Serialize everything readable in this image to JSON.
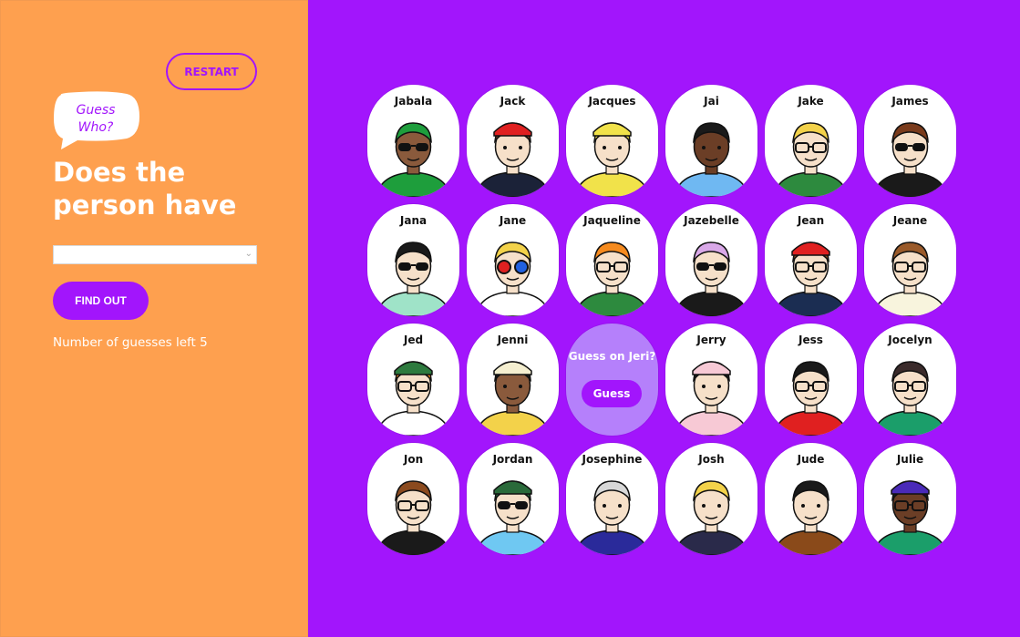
{
  "header": {
    "restart_label": "RESTART",
    "logo_line1": "Guess",
    "logo_line2": "Who?",
    "question": "Does the person have",
    "select_value": "",
    "findout_label": "FIND OUT",
    "guesses_text": "Number of guesses left 5"
  },
  "colors": {
    "panel": "#fea04f",
    "board": "#a215fc",
    "accent": "#a215fc",
    "highlight": "#b580fb"
  },
  "board": {
    "people": [
      {
        "name": "Jabala",
        "skin": "#8a5a3c",
        "hair": "#1e9e3c",
        "shirt": "#1e9e3c",
        "glasses": "sun",
        "hat": ""
      },
      {
        "name": "Jack",
        "skin": "#f6e0c9",
        "hair": "#6b3a1e",
        "shirt": "#1b2238",
        "glasses": "",
        "hat": "#e02020"
      },
      {
        "name": "Jacques",
        "skin": "#f6e0c9",
        "hair": "#f1e24a",
        "shirt": "#f1e24a",
        "glasses": "",
        "hat": "#f1e24a"
      },
      {
        "name": "Jai",
        "skin": "#6b3e26",
        "hair": "#1a1a1a",
        "shirt": "#6fb8f2",
        "glasses": "",
        "hat": ""
      },
      {
        "name": "Jake",
        "skin": "#f6e0c9",
        "hair": "#f3d24a",
        "shirt": "#2d8a3e",
        "glasses": "clear",
        "hat": ""
      },
      {
        "name": "James",
        "skin": "#f6e0c9",
        "hair": "#7a3b1c",
        "shirt": "#1a1a1a",
        "glasses": "sun",
        "hat": ""
      },
      {
        "name": "Jana",
        "skin": "#f6e0c9",
        "hair": "#1a1a1a",
        "shirt": "#9fe3c8",
        "glasses": "sun",
        "hat": ""
      },
      {
        "name": "Jane",
        "skin": "#f6e0c9",
        "hair": "#f3d24a",
        "shirt": "#ffffff",
        "glasses": "color",
        "hat": ""
      },
      {
        "name": "Jaqueline",
        "skin": "#f6e0c9",
        "hair": "#f58a1e",
        "shirt": "#2d8a3e",
        "glasses": "clear",
        "hat": ""
      },
      {
        "name": "Jazebelle",
        "skin": "#f6e0c9",
        "hair": "#d9a8e8",
        "shirt": "#1a1a1a",
        "glasses": "sun",
        "hat": ""
      },
      {
        "name": "Jean",
        "skin": "#f6e0c9",
        "hair": "#8b4a1e",
        "shirt": "#1b2d52",
        "glasses": "clear",
        "hat": "#e02020"
      },
      {
        "name": "Jeane",
        "skin": "#f6e0c9",
        "hair": "#9a5a2a",
        "shirt": "#f8f4dd",
        "glasses": "clear",
        "hat": ""
      },
      {
        "name": "Jed",
        "skin": "#f6e0c9",
        "hair": "#f58a1e",
        "shirt": "#ffffff",
        "glasses": "clear",
        "hat": "#2d7a3e"
      },
      {
        "name": "Jenni",
        "skin": "#8a5a3c",
        "hair": "#1a1a1a",
        "shirt": "#f3d24a",
        "glasses": "",
        "hat": "#f5efd0"
      },
      {
        "name": "Jeri",
        "skin": "#f6e0c9",
        "hair": "#333333",
        "shirt": "#333333",
        "glasses": "",
        "hat": ""
      },
      {
        "name": "Jerry",
        "skin": "#f6e0c9",
        "hair": "#1a1a1a",
        "shirt": "#f7c9d5",
        "glasses": "",
        "hat": "#f7c9d5"
      },
      {
        "name": "Jess",
        "skin": "#f6e0c9",
        "hair": "#1a1a1a",
        "shirt": "#e02020",
        "glasses": "clear",
        "hat": ""
      },
      {
        "name": "Jocelyn",
        "skin": "#f6e0c9",
        "hair": "#3a2a2a",
        "shirt": "#1b9e6a",
        "glasses": "clear",
        "hat": ""
      },
      {
        "name": "Jon",
        "skin": "#f6e0c9",
        "hair": "#8b4a1e",
        "shirt": "#1a1a1a",
        "glasses": "clear",
        "hat": ""
      },
      {
        "name": "Jordan",
        "skin": "#f6e0c9",
        "hair": "#2a6a3a",
        "shirt": "#6fc8f2",
        "glasses": "sun",
        "hat": "#2a6a3a"
      },
      {
        "name": "Josephine",
        "skin": "#f6e0c9",
        "hair": "#d8d8d8",
        "shirt": "#2a2a9a",
        "glasses": "",
        "hat": ""
      },
      {
        "name": "Josh",
        "skin": "#f6e0c9",
        "hair": "#f3d24a",
        "shirt": "#2a2a4a",
        "glasses": "",
        "hat": ""
      },
      {
        "name": "Jude",
        "skin": "#f6e0c9",
        "hair": "#1a1a1a",
        "shirt": "#8a4a1a",
        "glasses": "",
        "hat": ""
      },
      {
        "name": "Julie",
        "skin": "#6b3e26",
        "hair": "#1a1a1a",
        "shirt": "#1b9e6a",
        "glasses": "clear",
        "hat": "#4a2ab8"
      }
    ],
    "highlight": {
      "index": 14,
      "text": "Guess on Jeri?",
      "button_label": "Guess"
    }
  }
}
